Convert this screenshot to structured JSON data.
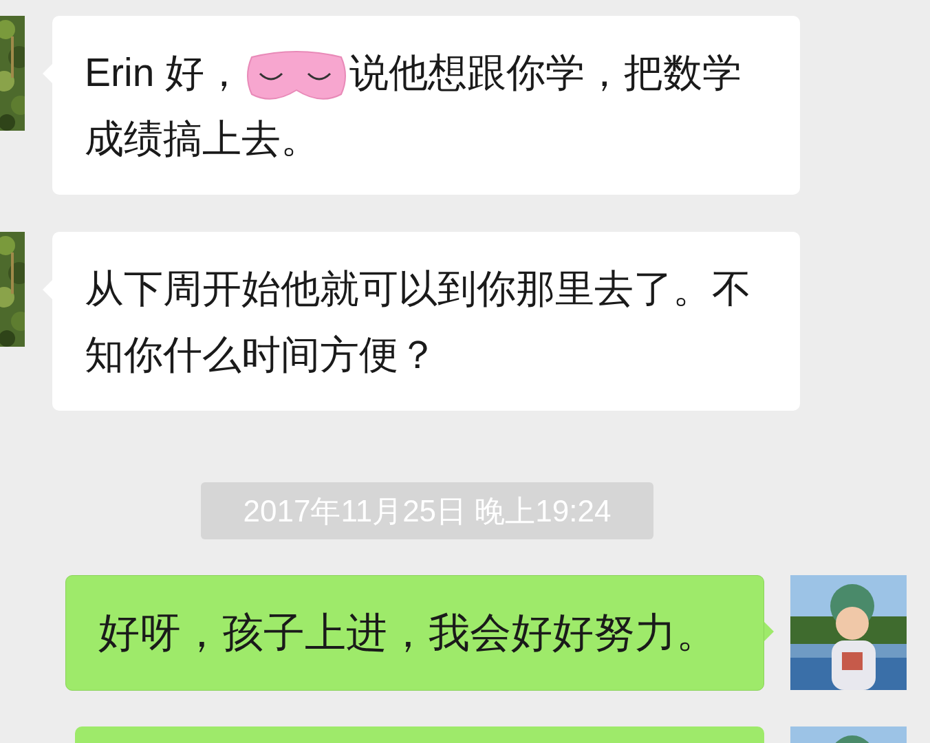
{
  "messages": [
    {
      "kind": "incoming",
      "parts": [
        {
          "kind": "text",
          "text": "Erin 好，"
        },
        {
          "kind": "sticker"
        },
        {
          "kind": "text",
          "text": "说他想跟你学，把数学"
        },
        {
          "kind": "text",
          "text": "成绩搞上去。"
        }
      ]
    },
    {
      "kind": "incoming",
      "parts": [
        {
          "kind": "text",
          "text": "从下周开始他就可以到你那里去了。不知你什么时间方便？"
        }
      ]
    },
    {
      "kind": "timestamp",
      "text": "2017年11月25日 晚上19:24"
    },
    {
      "kind": "outgoing",
      "parts": [
        {
          "kind": "text",
          "text": "好呀，孩子上进，我会好好努力。"
        }
      ]
    },
    {
      "kind": "outgoing"
    }
  ]
}
